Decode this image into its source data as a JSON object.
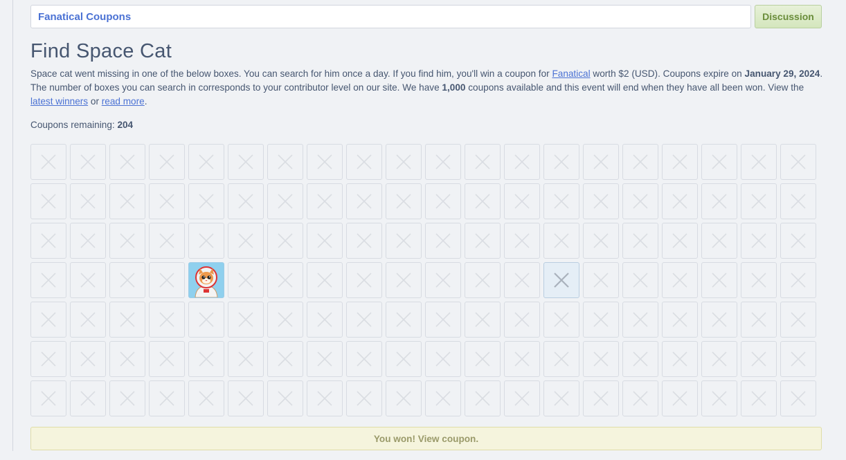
{
  "header": {
    "title": "Fanatical Coupons",
    "discussion_label": "Discussion"
  },
  "event": {
    "heading": "Find Space Cat",
    "intro": {
      "p1": "Space cat went missing in one of the below boxes. You can search for him once a day. If you find him, you'll win a coupon for ",
      "link_fanatical": "Fanatical",
      "p2": " worth $2 (USD). Coupons expire on ",
      "expiry": "January 29, 2024",
      "p3": ". The number of boxes you can search in corresponds to your contributor level on our site. We have ",
      "coupon_total": "1,000",
      "p4": " coupons available and this event will end when they have all been won. View the ",
      "link_winners": "latest winners",
      "p5": " or ",
      "link_read_more": "read more",
      "p6": "."
    },
    "remaining_label": "Coupons remaining: ",
    "remaining_count": "204",
    "grid": {
      "rows": 7,
      "cols": 20,
      "cell_icon": "close-x-icon",
      "found_cell": {
        "row": 4,
        "col": 5,
        "icon": "space-cat-icon"
      },
      "current_cell": {
        "row": 4,
        "col": 14
      }
    },
    "won_label": "You won! View coupon."
  },
  "colors": {
    "link": "#4b72d4",
    "text": "#465670",
    "discussion_green": "#6a8d3b",
    "won_bar": "#f5f4dd"
  }
}
